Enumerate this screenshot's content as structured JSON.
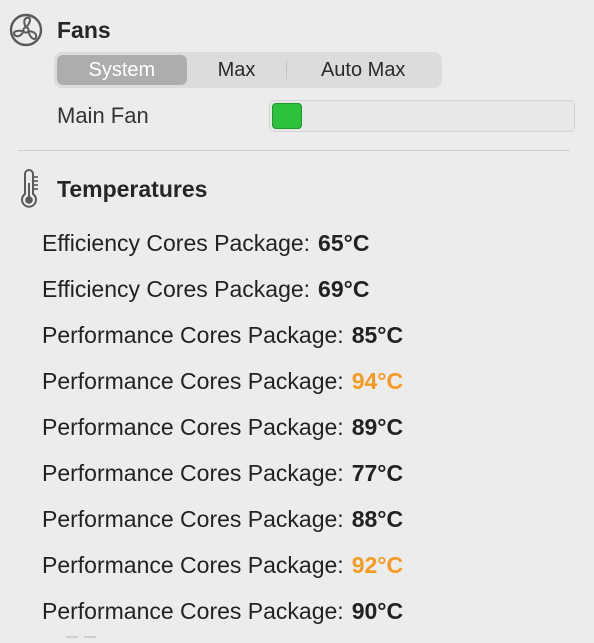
{
  "fans": {
    "title": "Fans",
    "icon": "fan-icon",
    "modes": [
      {
        "label": "System",
        "selected": true
      },
      {
        "label": "Max",
        "selected": false
      },
      {
        "label": "Auto Max",
        "selected": false
      }
    ],
    "main_fan": {
      "label": "Main Fan",
      "level": 0.1,
      "color": "#2ec23c"
    }
  },
  "temperatures": {
    "title": "Temperatures",
    "icon": "thermometer-icon",
    "items": [
      {
        "label": "Efficiency Cores Package:",
        "value": "65°C",
        "color": "#222222"
      },
      {
        "label": "Efficiency Cores Package:",
        "value": "69°C",
        "color": "#222222"
      },
      {
        "label": "Performance Cores Package:",
        "value": "85°C",
        "color": "#222222"
      },
      {
        "label": "Performance Cores Package:",
        "value": "94°C",
        "color": "#f59a23"
      },
      {
        "label": "Performance Cores Package:",
        "value": "89°C",
        "color": "#222222"
      },
      {
        "label": "Performance Cores Package:",
        "value": "77°C",
        "color": "#222222"
      },
      {
        "label": "Performance Cores Package:",
        "value": "88°C",
        "color": "#222222"
      },
      {
        "label": "Performance Cores Package:",
        "value": "92°C",
        "color": "#f59a23"
      },
      {
        "label": "Performance Cores Package:",
        "value": "90°C",
        "color": "#222222"
      }
    ]
  }
}
